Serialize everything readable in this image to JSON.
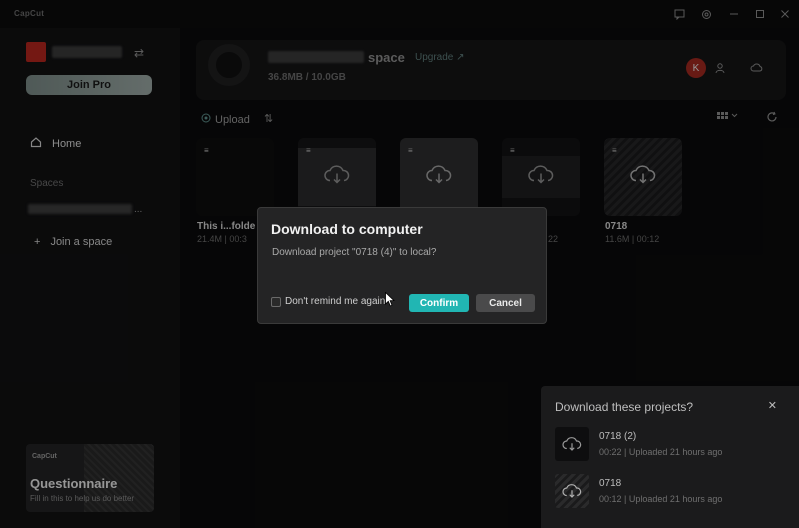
{
  "app": {
    "logo_text": "CapCut"
  },
  "window_controls": {
    "feedback": "feedback-icon",
    "settings": "gear-icon",
    "minimize": "minimize-icon",
    "maximize": "maximize-icon",
    "close": "close-icon"
  },
  "sidebar": {
    "join_pro_label": "Join Pro",
    "home_label": "Home",
    "spaces_label": "Spaces",
    "space_item_suffix": "...",
    "join_space_label": "Join a space",
    "promo": {
      "brand": "CapCut",
      "title": "Questionnaire",
      "subtitle": "Fill in this to help us do better"
    }
  },
  "space_header": {
    "space_name": "space",
    "upgrade_label": "Upgrade ↗",
    "storage": "36.8MB / 10.0GB",
    "user_initial": "K"
  },
  "toolbar": {
    "upload_label": "Upload"
  },
  "projects": [
    {
      "name": "This i...folde",
      "meta": "21.4M | 00:3"
    },
    {
      "name": "",
      "meta": ""
    },
    {
      "name": "",
      "meta": ""
    },
    {
      "name": "",
      "meta": "22"
    },
    {
      "name": "0718",
      "meta": "11.6M | 00:12"
    }
  ],
  "dialog": {
    "title": "Download to computer",
    "message": "Download project  \"0718 (4)\"  to local?",
    "checkbox_label": "Don't remind me again",
    "confirm_label": "Confirm",
    "cancel_label": "Cancel"
  },
  "download_panel": {
    "title": "Download these projects?",
    "items": [
      {
        "name": "0718 (2)",
        "meta": "00:22 | Uploaded 21 hours ago"
      },
      {
        "name": "0718",
        "meta": "00:12 | Uploaded 21 hours ago"
      }
    ]
  },
  "colors": {
    "accent": "#21b6b3",
    "avatar": "#a0281f"
  }
}
